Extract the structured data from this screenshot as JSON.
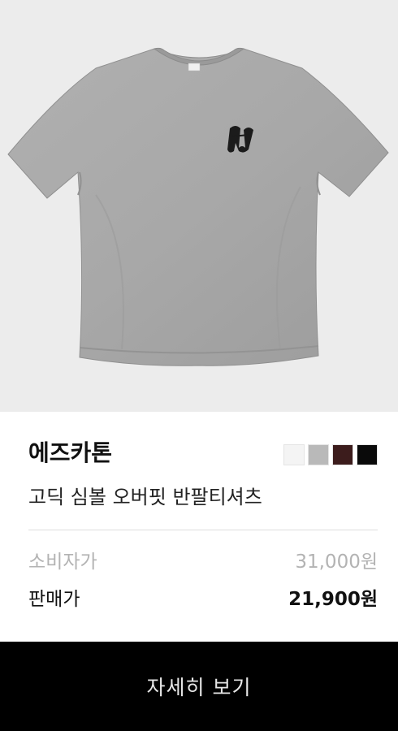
{
  "product": {
    "brand": "에즈카톤",
    "name": "고딕 심볼 오버핏 반팔티셔츠",
    "image_icon": "gray-tshirt-with-gothic-h-logo"
  },
  "swatches": [
    {
      "name": "white",
      "color": "#f4f4f4"
    },
    {
      "name": "gray",
      "color": "#b9b9b9"
    },
    {
      "name": "brown",
      "color": "#3c1c1c"
    },
    {
      "name": "black",
      "color": "#0a0a0a"
    }
  ],
  "pricing": {
    "retail_label": "소비자가",
    "retail_value": "31,000원",
    "sale_label": "판매가",
    "sale_value": "21,900원"
  },
  "cta": {
    "label": "자세히 보기"
  },
  "colors": {
    "image_bg": "#ececec",
    "shirt": "#a9a9a9",
    "cta_bg": "#000000",
    "cta_text": "#e6e6e6"
  }
}
